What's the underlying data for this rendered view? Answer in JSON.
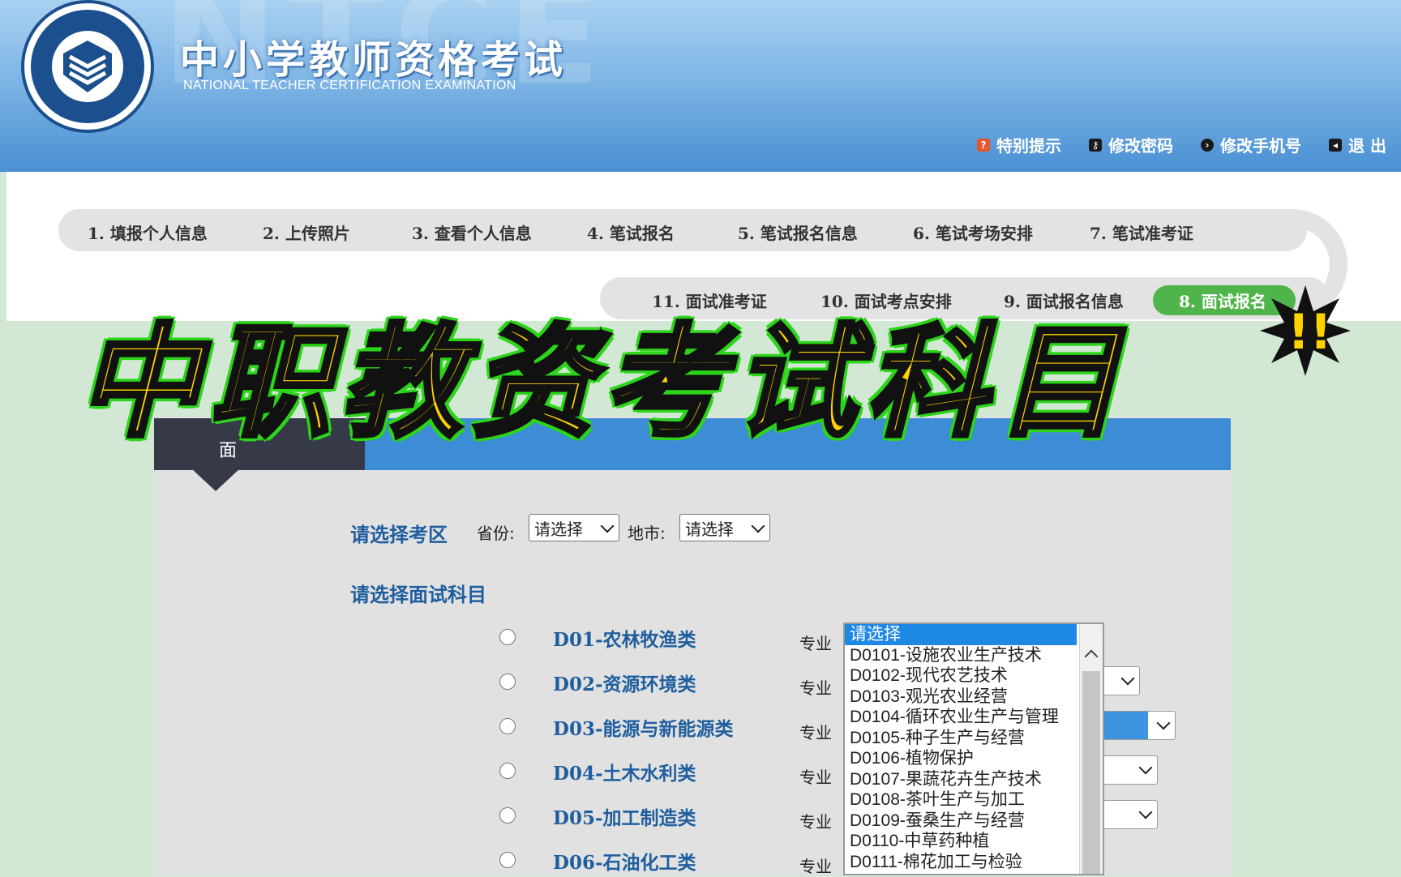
{
  "header": {
    "bg_letters": "NTCE",
    "title": "中小学教师资格考试",
    "subtitle": "NATIONAL TEACHER CERTIFICATION EXAMINATION",
    "links": [
      {
        "label": "特别提示",
        "icon": "question-icon"
      },
      {
        "label": "修改密码",
        "icon": "key-icon"
      },
      {
        "label": "修改手机号",
        "icon": "phone-icon"
      },
      {
        "label": "退 出",
        "icon": "logout-icon"
      }
    ]
  },
  "steps": {
    "row1": [
      "1. 填报个人信息",
      "2. 上传照片",
      "3. 查看个人信息",
      "4. 笔试报名",
      "5. 笔试报名信息",
      "6. 笔试考场安排",
      "7. 笔试准考证"
    ],
    "row2": [
      "11. 面试准考证",
      "10. 面试考点安排",
      "9. 面试报名信息",
      "8. 面试报名"
    ],
    "active": "8. 面试报名"
  },
  "banner": {
    "text": "中职教资考试科目",
    "exclaim": "!!"
  },
  "panel": {
    "tab_label": "面",
    "region_label": "请选择考区",
    "province_label": "省份:",
    "province_value": "请选择",
    "city_label": "地市:",
    "city_value": "请选择",
    "subject_label": "请选择面试科目",
    "major_label": "专业",
    "subjects": [
      "D01-农林牧渔类",
      "D02-资源环境类",
      "D03-能源与新能源类",
      "D04-土木水利类",
      "D05-加工制造类",
      "D06-石油化工类"
    ]
  },
  "dropdown": {
    "options": [
      "请选择",
      "D0101-设施农业生产技术",
      "D0102-现代农艺技术",
      "D0103-观光农业经营",
      "D0104-循环农业生产与管理",
      "D0105-种子生产与经营",
      "D0106-植物保护",
      "D0107-果蔬花卉生产技术",
      "D0108-茶叶生产与加工",
      "D0109-蚕桑生产与经营",
      "D0110-中草药种植",
      "D0111-棉花加工与检验"
    ],
    "selected": "请选择"
  },
  "colors": {
    "header_blue": "#4a90d3",
    "active_step_green": "#4fb54a",
    "subject_blue": "#1f5e9e",
    "banner_yellow": "#ffd200",
    "banner_outline_green": "#2cd41a",
    "page_green": "#d2e8d4"
  }
}
